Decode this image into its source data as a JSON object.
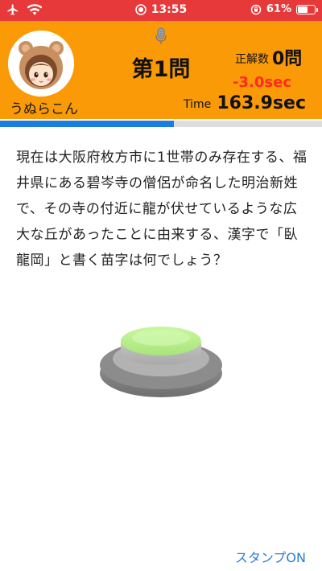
{
  "status_bar": {
    "time": "13:55",
    "battery_percent": "61%",
    "battery_level": 0.61,
    "icons": [
      "airplane-icon",
      "wifi-icon",
      "recording-icon",
      "orientation-lock-icon",
      "battery-icon"
    ]
  },
  "header": {
    "username": "うぬらこん",
    "question_number": "第1問",
    "score_label": "正解数",
    "score_value": "0問",
    "penalty": "-3.0sec",
    "time_label": "Time",
    "time_value": "163.9sec"
  },
  "progress": {
    "fraction": 0.54
  },
  "question": {
    "text": "現在は大阪府枚方市に1世帯のみ存在する、福井県にある碧岑寺の僧侶が命名した明治新姓で、その寺の付近に龍が伏せているような広大な丘があったことに由来する、漢字で「臥龍岡」と書く苗字は何でしょう？"
  },
  "footer": {
    "stamp_label": "スタンプON"
  },
  "colors": {
    "status_bar": "#e8393a",
    "header": "#fb9a07",
    "penalty": "#ff2b1c",
    "progress_fill": "#1a7de0",
    "link": "#2b7cd9",
    "buzzer_top": "#b9f08a"
  }
}
